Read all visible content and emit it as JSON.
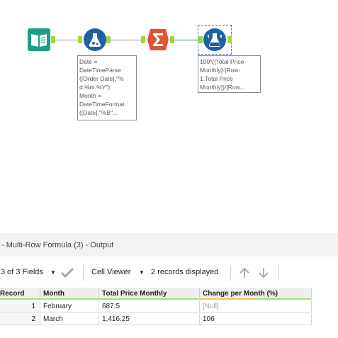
{
  "workflow": {
    "tools": [
      {
        "name": "input-data-tool",
        "icon": "book-icon"
      },
      {
        "name": "formula-tool",
        "icon": "flask-icon"
      },
      {
        "name": "summarize-tool",
        "icon": "sigma-icon"
      },
      {
        "name": "multi-row-formula-tool",
        "icon": "flask-drops-icon"
      }
    ],
    "annotations": {
      "formula": "Date =\nDateTimeParse\n([Order Date],\"%\nd.%m.%Y\")\nMonth =\nDateTimeFormat\n([Date],\"%B\"...",
      "multirow": "100*([Total Price\nMonthly]-[Row-\n1:Total Price\nMonthly])/[Row..."
    },
    "colors": {
      "input": "#1a9e85",
      "formula": "#1f5fa3",
      "summarize": "#e0533a",
      "multirow": "#1f5fa3",
      "anchor": "#9bd83c"
    }
  },
  "results": {
    "title": "- Multi-Row Formula (3) - Output",
    "toolbar": {
      "fields_label": "3 of 3 Fields",
      "cell_viewer_label": "Cell Viewer",
      "records_label": "2 records displayed"
    },
    "columns": [
      "Record",
      "Month",
      "Total Price Monthly",
      "Change per Month (%)"
    ],
    "rows": [
      {
        "record": "1",
        "month": "February",
        "total": "687.5",
        "change": "[Null]"
      },
      {
        "record": "2",
        "month": "March",
        "total": "1,416.25",
        "change": "106"
      }
    ]
  }
}
